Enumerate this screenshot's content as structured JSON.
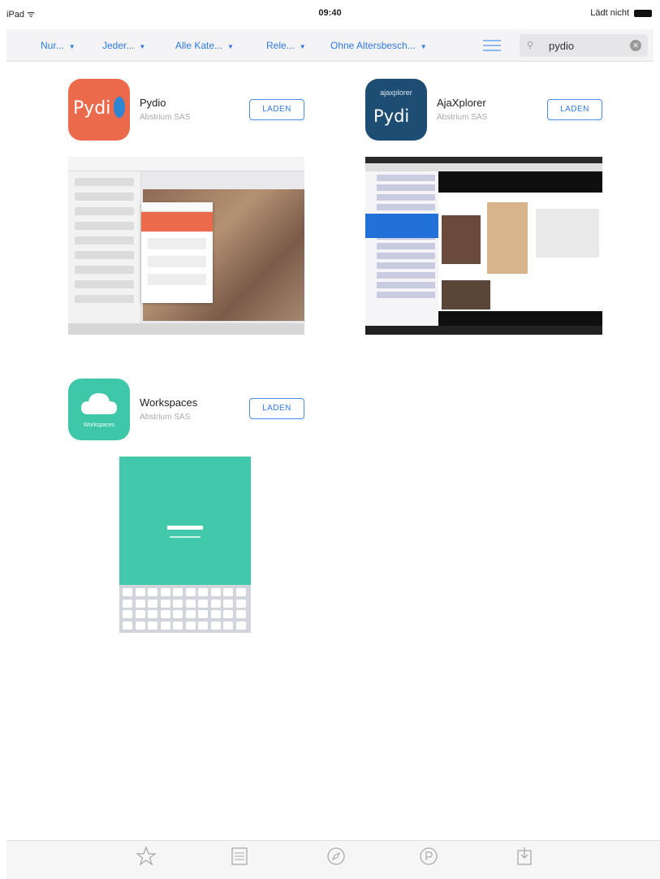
{
  "status_bar": {
    "left": "iPad ᯤ",
    "time": "09:40",
    "right": "Lädt nicht"
  },
  "filters": [
    {
      "label": "Nur..."
    },
    {
      "label": "Jeder..."
    },
    {
      "label": "Alle Kate..."
    },
    {
      "label": "Rele..."
    },
    {
      "label": "Ohne Altersbesch..."
    }
  ],
  "search": {
    "value": "pydio"
  },
  "results": [
    {
      "name": "Pydio",
      "developer": "Abstrium SAS",
      "button": "LADEN",
      "icon": "pydio-app-icon",
      "icon_text": "Pydi"
    },
    {
      "name": "AjaXplorer",
      "developer": "Abstrium SAS",
      "button": "LADEN",
      "icon": "ajaxplorer-app-icon",
      "icon_top_text": "ajaxplorer",
      "icon_text": "Pydi"
    },
    {
      "name": "Workspaces",
      "developer": "Abstrium SAS",
      "button": "LADEN",
      "icon": "workspaces-app-icon",
      "icon_caption": "Workspaces"
    }
  ],
  "tab_bar": [
    {
      "icon": "star-icon"
    },
    {
      "icon": "list-icon"
    },
    {
      "icon": "compass-icon"
    },
    {
      "icon": "purchased-icon"
    },
    {
      "icon": "updates-icon"
    }
  ]
}
